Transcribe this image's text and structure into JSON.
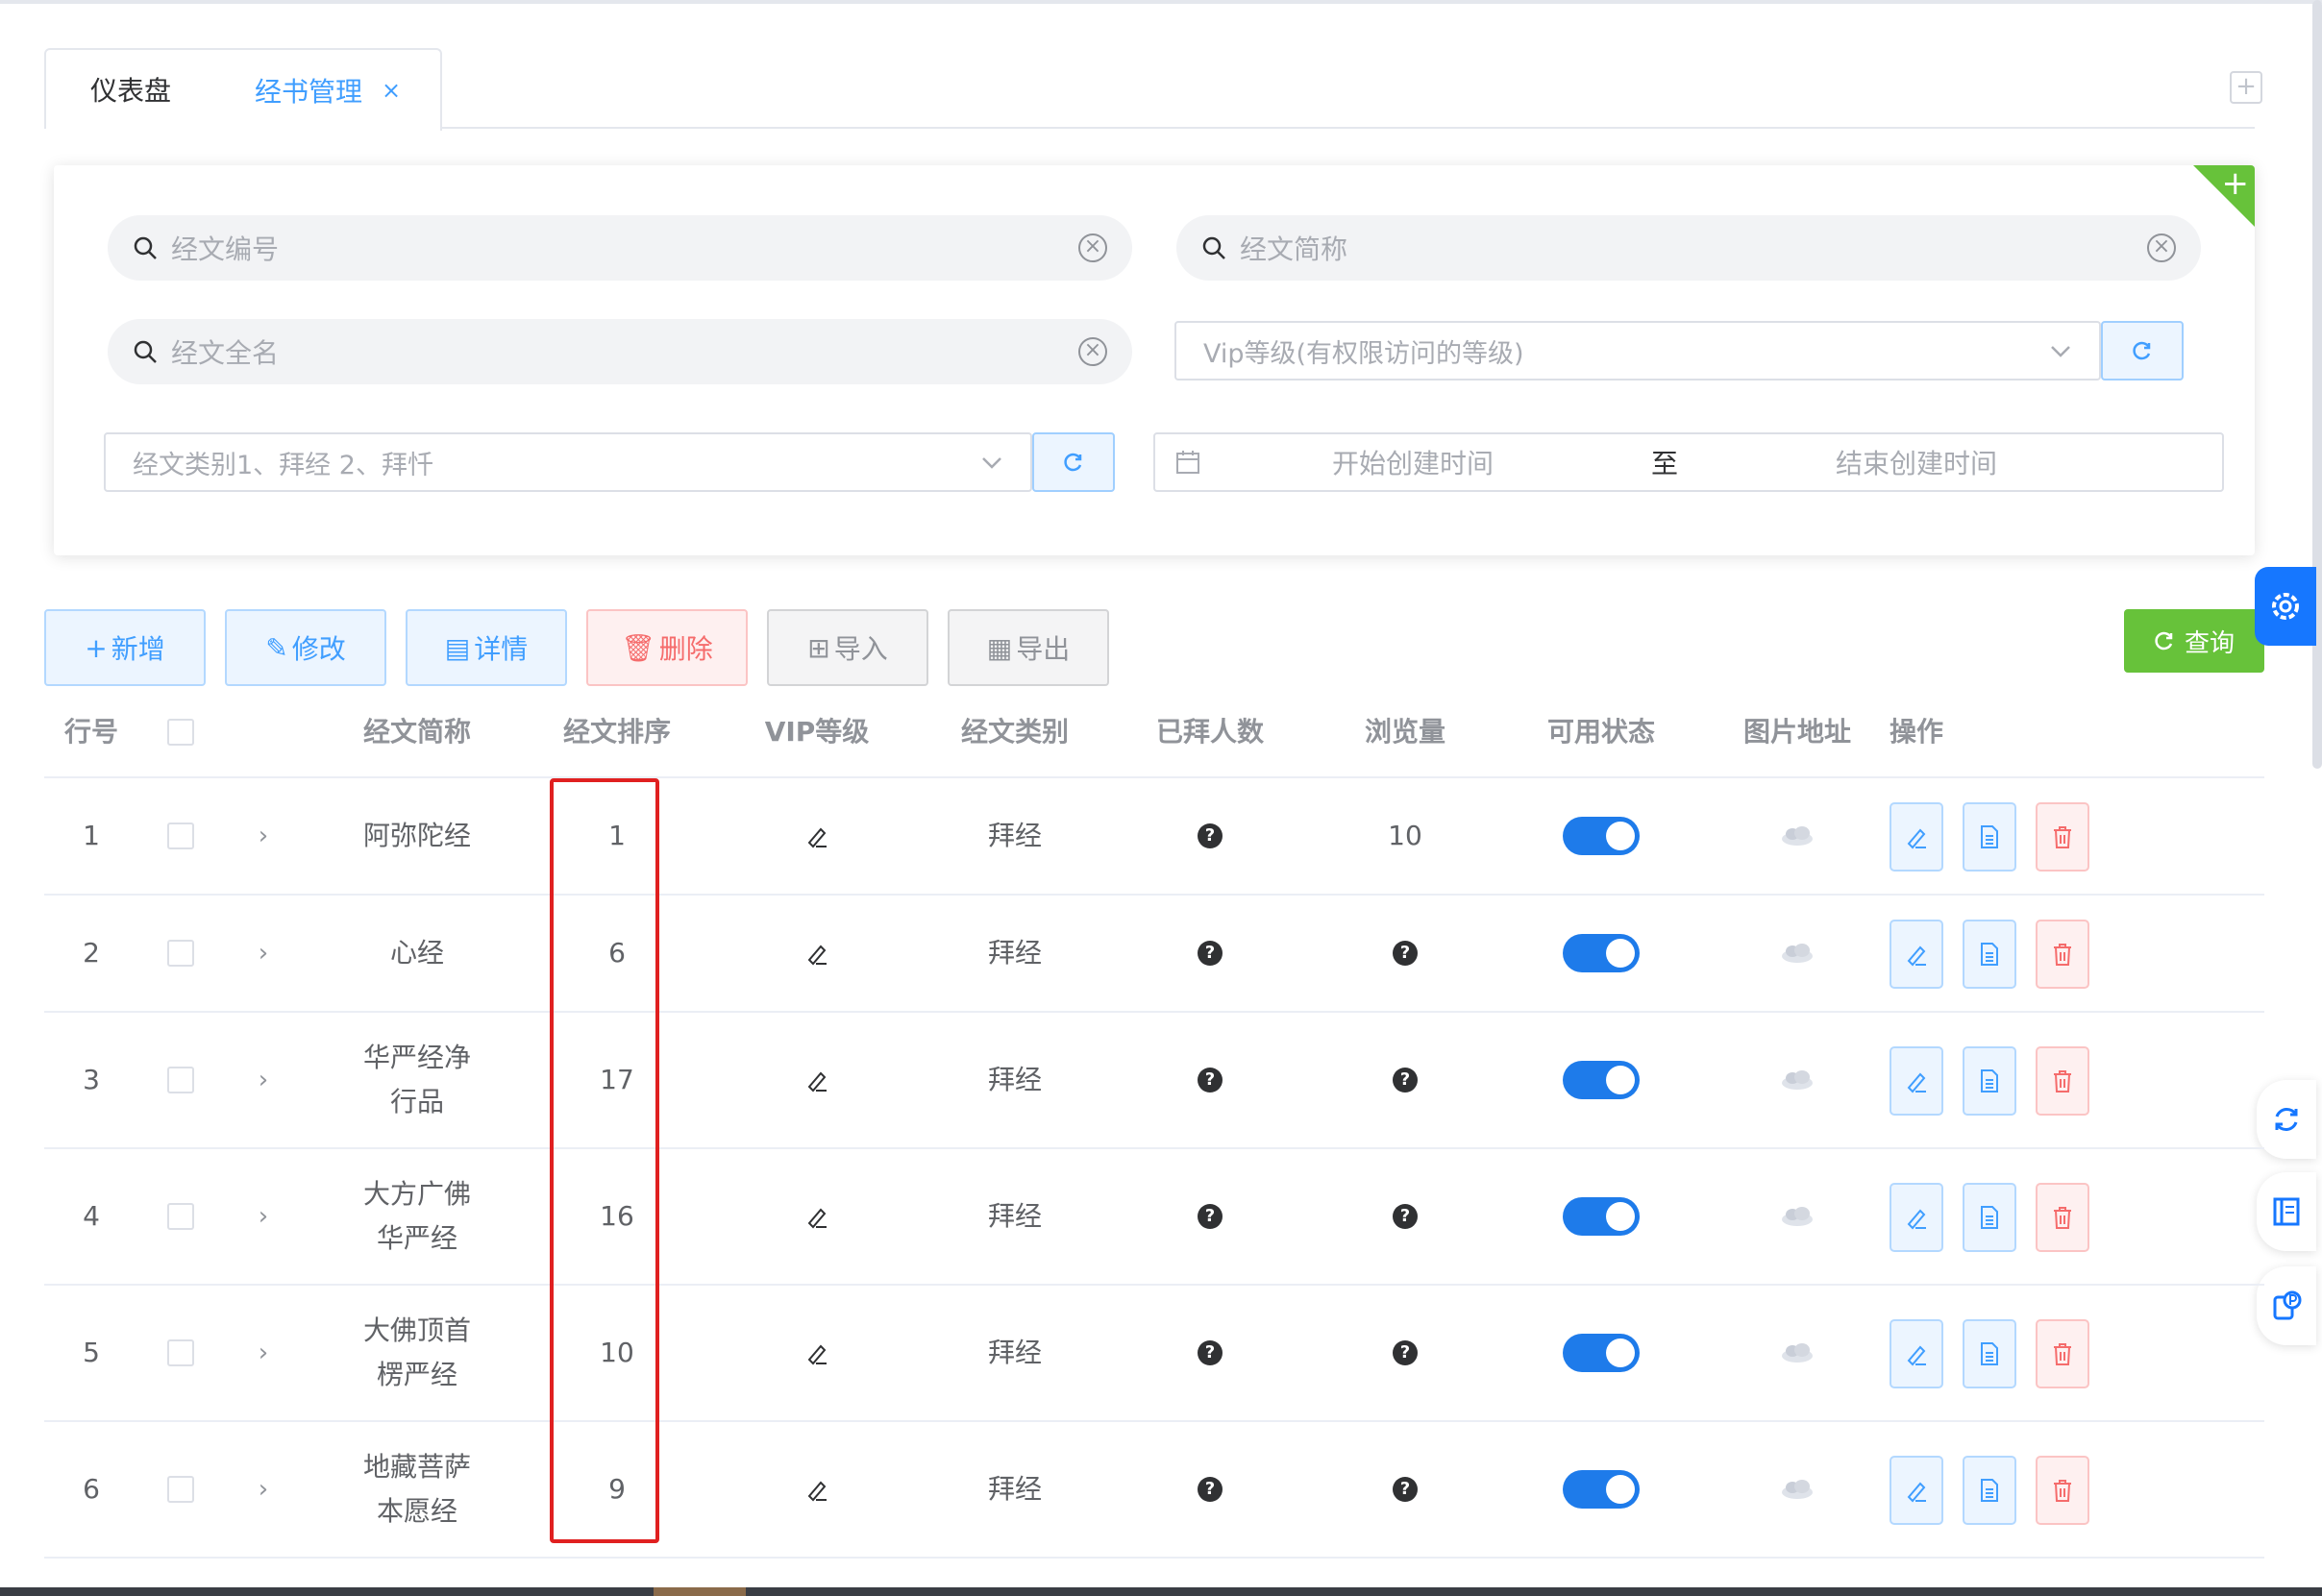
{
  "tabs": [
    {
      "label": "仪表盘"
    },
    {
      "label": "经书管理",
      "close": "×"
    }
  ],
  "search": {
    "code_placeholder": "经文编号",
    "short_placeholder": "经文简称",
    "full_placeholder": "经文全名",
    "vip_placeholder": "Vip等级(有权限访问的等级)",
    "category_placeholder": "经文类别1、拜经 2、拜忏",
    "date_start": "开始创建时间",
    "date_sep": "至",
    "date_end": "结束创建时间"
  },
  "toolbar": {
    "add": "新增",
    "edit": "修改",
    "detail": "详情",
    "delete": "删除",
    "import": "导入",
    "export": "导出",
    "query": "查询"
  },
  "table": {
    "headers": [
      "行号",
      "经文简称",
      "经文排序",
      "VIP等级",
      "经文类别",
      "已拜人数",
      "浏览量",
      "可用状态",
      "图片地址",
      "操作"
    ],
    "rows": [
      {
        "no": "1",
        "name": "阿弥陀经",
        "order": "1",
        "category": "拜经",
        "views": "10"
      },
      {
        "no": "2",
        "name": "心经",
        "order": "6",
        "category": "拜经",
        "views": ""
      },
      {
        "no": "3",
        "name": "华严经净行品",
        "order": "17",
        "category": "拜经",
        "views": ""
      },
      {
        "no": "4",
        "name": "大方广佛华严经",
        "order": "16",
        "category": "拜经",
        "views": ""
      },
      {
        "no": "5",
        "name": "大佛顶首楞严经",
        "order": "10",
        "category": "拜经",
        "views": ""
      },
      {
        "no": "6",
        "name": "地藏菩萨本愿经",
        "order": "9",
        "category": "拜经",
        "views": ""
      }
    ]
  },
  "colors": {
    "primary": "#409eff",
    "success": "#67c23a",
    "danger": "#f56c6c",
    "highlight": "#e02020"
  }
}
